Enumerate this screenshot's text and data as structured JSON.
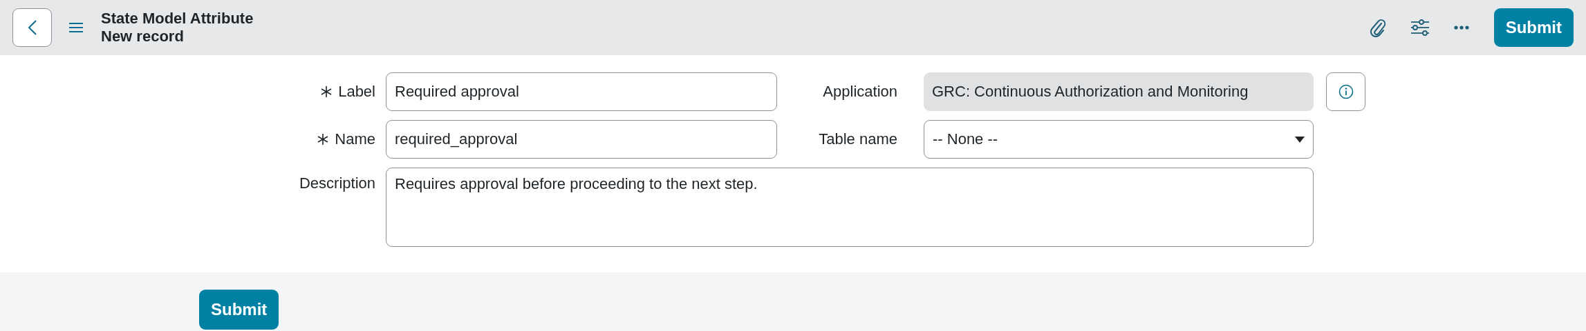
{
  "header": {
    "title": "State Model Attribute",
    "subtitle": "New record",
    "submit": "Submit"
  },
  "fields": [
    {
      "kind": "text",
      "label": "Label",
      "required": true,
      "value": "Required approval"
    },
    {
      "kind": "readonly",
      "label": "Application",
      "required": false,
      "value": "GRC: Continuous Authorization and Monitoring"
    },
    {
      "kind": "text",
      "label": "Name",
      "required": true,
      "value": "required_approval"
    },
    {
      "kind": "select",
      "label": "Table name",
      "required": false,
      "value": "-- None --"
    },
    {
      "kind": "textarea",
      "label": "Description",
      "required": false,
      "value": "Requires approval before proceeding to the next step."
    }
  ],
  "footer": {
    "submit": "Submit"
  }
}
